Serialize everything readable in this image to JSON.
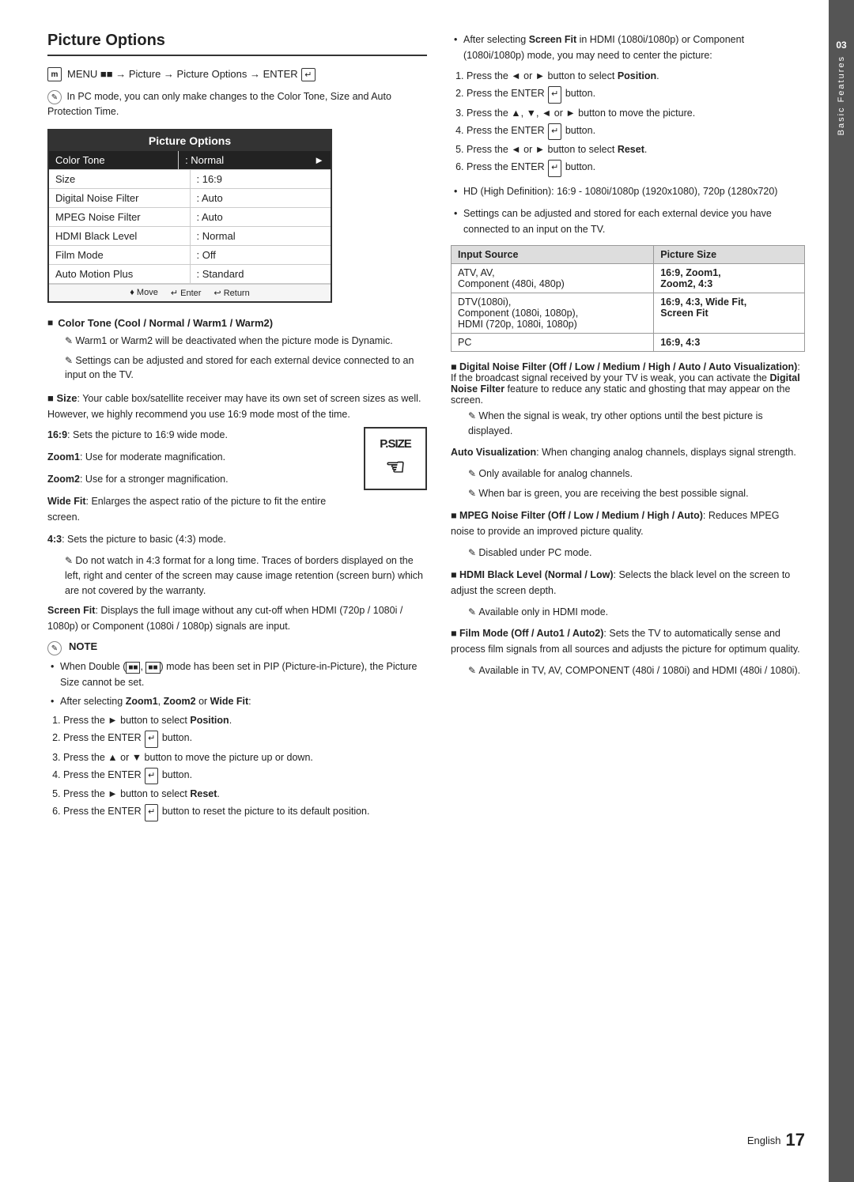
{
  "page": {
    "title": "Picture Options",
    "page_number": "17",
    "language": "English",
    "section_number": "03",
    "section_label": "Basic Features"
  },
  "menu_path": {
    "icon": "m",
    "path": "MENU → Picture → Picture Options → ENTER"
  },
  "pc_note": "In PC mode, you can only make changes to the Color Tone, Size and Auto Protection Time.",
  "picture_options_table": {
    "title": "Picture Options",
    "rows": [
      {
        "label": "Color Tone",
        "value": ": Normal",
        "highlighted": true,
        "arrow": "►"
      },
      {
        "label": "Size",
        "value": ": 16:9",
        "highlighted": false
      },
      {
        "label": "Digital Noise Filter",
        "value": ": Auto",
        "highlighted": false
      },
      {
        "label": "MPEG Noise Filter",
        "value": ": Auto",
        "highlighted": false
      },
      {
        "label": "HDMI Black Level",
        "value": ": Normal",
        "highlighted": false
      },
      {
        "label": "Film Mode",
        "value": ": Off",
        "highlighted": false
      },
      {
        "label": "Auto Motion Plus",
        "value": ": Standard",
        "highlighted": false
      }
    ],
    "footer": "♦ Move  ↵ Enter  ↩ Return"
  },
  "color_tone": {
    "header": "Color Tone (Cool / Normal / Warm1 / Warm2)",
    "note1": "Warm1 or Warm2 will be deactivated when the picture mode is Dynamic.",
    "note2": "Settings can be adjusted and stored for each external device connected to an input on the TV."
  },
  "size": {
    "header": "Size",
    "body": "Your cable box/satellite receiver may have its own set of screen sizes as well. However, we highly recommend you use 16:9 mode most of the time.",
    "options": [
      {
        "label": "16:9",
        "desc": "Sets the picture to 16:9 wide mode."
      },
      {
        "label": "Zoom1",
        "desc": "Use for moderate magnification."
      },
      {
        "label": "Zoom2",
        "desc": "Use for a stronger magnification."
      },
      {
        "label": "Wide Fit",
        "desc": "Enlarges the aspect ratio of the picture to fit the entire screen."
      },
      {
        "label": "4:3",
        "desc": "Sets the picture to basic (4:3) mode."
      },
      {
        "note": "Do not watch in 4:3 format for a long time. Traces of borders displayed on the left, right and center of the screen may cause image retention (screen burn) which are not covered by the warranty."
      },
      {
        "label": "Screen Fit",
        "desc": "Displays the full image without any cut-off when HDMI (720p / 1080i / 1080p) or Component (1080i / 1080p) signals are input."
      }
    ]
  },
  "note_section": {
    "title": "NOTE",
    "bullets": [
      "When Double (■■, ■■) mode has been set in PIP (Picture-in-Picture), the Picture Size cannot be set.",
      "After selecting Zoom1, Zoom2 or Wide Fit:"
    ],
    "zoom_steps": [
      "Press the ► button to select Position.",
      "Press the ENTER ↵ button.",
      "Press the ▲ or ▼ button to move the picture up or down.",
      "Press the ENTER ↵ button.",
      "Press the ► button to select Reset.",
      "Press the ENTER ↵ button to reset the picture to its default position."
    ]
  },
  "right_col": {
    "screen_fit_note": "After selecting Screen Fit in HDMI (1080i/1080p) or Component (1080i/1080p) mode, you may need to center the picture:",
    "screen_fit_steps": [
      "Press the ◄ or ► button to select Position.",
      "Press the ENTER ↵ button.",
      "Press the ▲, ▼, ◄ or ► button to move the picture.",
      "Press the ENTER ↵ button.",
      "Press the ◄ or ► button to select Reset.",
      "Press the ENTER ↵ button."
    ],
    "hd_note": "HD (High Definition): 16:9 - 1080i/1080p (1920x1080), 720p (1280x720)",
    "settings_note": "Settings can be adjusted and stored for each external device you have connected to an input on the TV.",
    "input_table": {
      "headers": [
        "Input Source",
        "Picture Size"
      ],
      "rows": [
        {
          "source": "ATV, AV,\nComponent (480i, 480p)",
          "size": "16:9, Zoom1, Zoom2, 4:3"
        },
        {
          "source": "DTV(1080i),\nComponent (1080i, 1080p),\nHDMI (720p, 1080i, 1080p)",
          "size": "16:9, 4:3, Wide Fit, Screen Fit"
        },
        {
          "source": "PC",
          "size": "16:9, 4:3"
        }
      ]
    },
    "dnf_header": "Digital Noise Filter (Off / Low / Medium / High / Auto / Auto Visualization)",
    "dnf_body": "If the broadcast signal received by your TV is weak, you can activate the Digital Noise Filter feature to reduce any static and ghosting that may appear on the screen.",
    "dnf_note1": "When the signal is weak, try other options until the best picture is displayed.",
    "auto_viz": "Auto Visualization: When changing analog channels, displays signal strength.",
    "auto_viz_note1": "Only available for analog channels.",
    "auto_viz_note2": "When bar is green, you are receiving the best possible signal.",
    "mpeg_header": "MPEG Noise Filter (Off / Low / Medium / High / Auto)",
    "mpeg_body": "Reduces MPEG noise to provide an improved picture quality.",
    "mpeg_note": "Disabled under PC mode.",
    "hdmi_header": "HDMI Black Level (Normal / Low)",
    "hdmi_body": "Selects the black level on the screen to adjust the screen depth.",
    "hdmi_note": "Available only in HDMI mode.",
    "film_header": "Film Mode (Off / Auto1 / Auto2)",
    "film_body": "Sets the TV to automatically sense and process film signals from all sources and adjusts the picture for optimum quality.",
    "film_note": "Available in TV, AV, COMPONENT (480i / 1080i) and HDMI (480i / 1080i)."
  }
}
